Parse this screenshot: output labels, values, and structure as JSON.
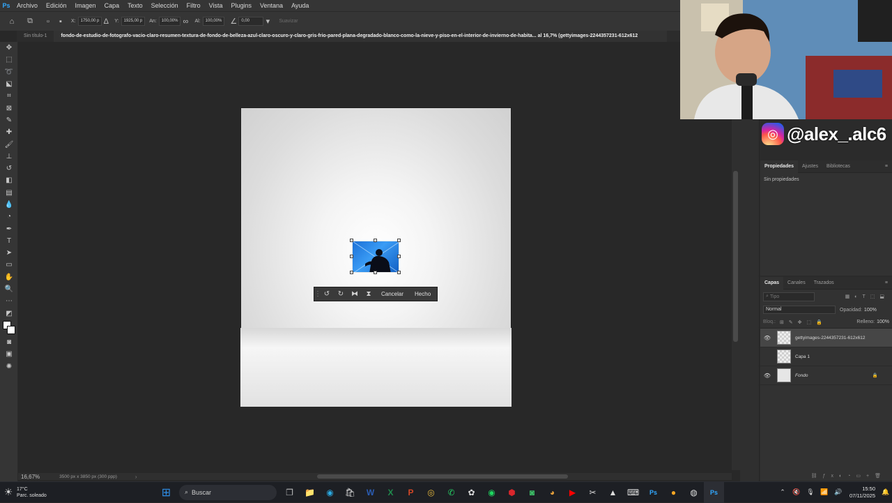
{
  "menubar": {
    "logo": "Ps",
    "items": [
      "Archivo",
      "Edición",
      "Imagen",
      "Capa",
      "Texto",
      "Selección",
      "Filtro",
      "Vista",
      "Plugins",
      "Ventana",
      "Ayuda"
    ]
  },
  "options": {
    "x_label": "X:",
    "x_value": "1750,00 p",
    "y_label": "Y:",
    "y_value": "1925,00 p",
    "w_label": "An:",
    "w_value": "100,00%",
    "h_label": "Al:",
    "h_value": "100,00%",
    "angle_value": "0,00",
    "interp": "Suavizar"
  },
  "tabs": {
    "inactive": "Sin título-1",
    "active": "fondo-de-estudio-de-fotografo-vacio-claro-resumen-textura-de-fondo-de-belleza-azul-claro-oscuro-y-claro-gris-frio-pared-plana-degradado-blanco-como-la-nieve-y-piso-en-el-interior-de-invierno-de-habita... al 16,7% (gettyimages-2244357231-612x612"
  },
  "context_bar": {
    "cancel": "Cancelar",
    "done": "Hecho"
  },
  "status": {
    "zoom": "16,67%",
    "dims": "3500 px x 3850 px (300 ppp)"
  },
  "properties": {
    "tabs": [
      "Propiedades",
      "Ajustes",
      "Bibliotecas"
    ],
    "empty": "Sin propiedades"
  },
  "layers": {
    "tabs": [
      "Capas",
      "Canales",
      "Trazados"
    ],
    "filter_placeholder": "Tipo",
    "blend": "Normal",
    "opacity_label": "Opacidad:",
    "opacity": "100%",
    "lock_label": "Bloq.:",
    "fill_label": "Relleno:",
    "fill": "100%",
    "items": [
      {
        "name": "gettyimages-2244357231-612x612",
        "visible": "👁"
      },
      {
        "name": "Capa 1",
        "visible": ""
      },
      {
        "name": "Fondo",
        "visible": "👁"
      }
    ]
  },
  "stream": {
    "handle": "@alex_.alc6"
  },
  "taskbar": {
    "weather_temp": "17°C",
    "weather_desc": "Parc. soleado",
    "search": "Buscar",
    "time": "15:50",
    "date": "07/11/2025"
  }
}
